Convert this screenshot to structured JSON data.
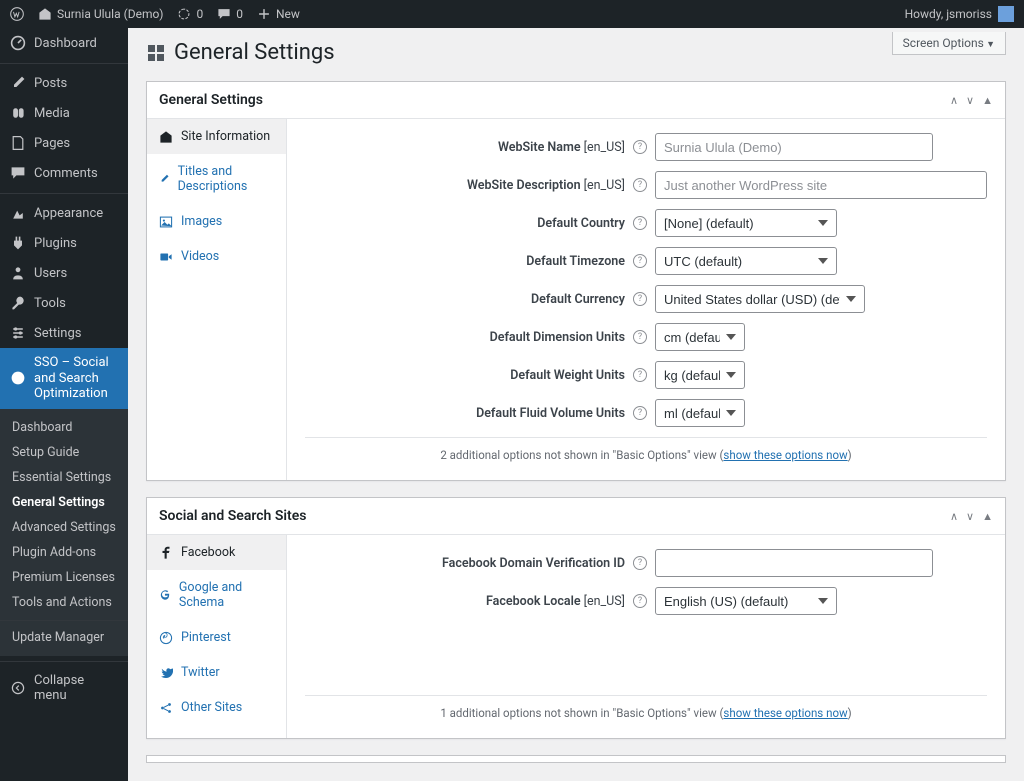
{
  "adminbar": {
    "site_name": "Surnia Ulula (Demo)",
    "updates_count": "0",
    "comments_count": "0",
    "new_label": "New",
    "howdy": "Howdy, jsmoriss"
  },
  "screen_options_label": "Screen Options",
  "page_title": "General Settings",
  "sidebar": {
    "dashboard": "Dashboard",
    "posts": "Posts",
    "media": "Media",
    "pages": "Pages",
    "comments": "Comments",
    "appearance": "Appearance",
    "plugins": "Plugins",
    "users": "Users",
    "tools": "Tools",
    "settings": "Settings",
    "sso": "SSO – Social and Search Optimization",
    "collapse": "Collapse menu"
  },
  "sso_submenu": {
    "dashboard": "Dashboard",
    "setup_guide": "Setup Guide",
    "essential": "Essential Settings",
    "general": "General Settings",
    "advanced": "Advanced Settings",
    "addons": "Plugin Add-ons",
    "licenses": "Premium Licenses",
    "tools_actions": "Tools and Actions",
    "update_manager": "Update Manager"
  },
  "box1": {
    "title": "General Settings",
    "tabs": {
      "site_info": "Site Information",
      "titles_desc": "Titles and Descriptions",
      "images": "Images",
      "videos": "Videos"
    },
    "fields": {
      "website_name_label": "WebSite Name",
      "website_name_locale": "[en_US]",
      "website_name_placeholder": "Surnia Ulula (Demo)",
      "website_desc_label": "WebSite Description",
      "website_desc_locale": "[en_US]",
      "website_desc_placeholder": "Just another WordPress site",
      "default_country_label": "Default Country",
      "default_country_value": "[None] (default)",
      "default_timezone_label": "Default Timezone",
      "default_timezone_value": "UTC (default)",
      "default_currency_label": "Default Currency",
      "default_currency_value": "United States dollar (USD) (defaul",
      "default_dim_label": "Default Dimension Units",
      "default_dim_value": "cm (defau",
      "default_weight_label": "Default Weight Units",
      "default_weight_value": "kg (defaul",
      "default_fluid_label": "Default Fluid Volume Units",
      "default_fluid_value": "ml (defaul"
    },
    "note_prefix": "2 additional options not shown in \"Basic Options\" view (",
    "note_link": "show these options now",
    "note_suffix": ")"
  },
  "box2": {
    "title": "Social and Search Sites",
    "tabs": {
      "facebook": "Facebook",
      "google": "Google and Schema",
      "pinterest": "Pinterest",
      "twitter": "Twitter",
      "other": "Other Sites"
    },
    "fields": {
      "fb_domain_label": "Facebook Domain Verification ID",
      "fb_locale_label": "Facebook Locale",
      "fb_locale_locale": "[en_US]",
      "fb_locale_value": "English (US) (default)"
    },
    "note_prefix": "1 additional options not shown in \"Basic Options\" view (",
    "note_link": "show these options now",
    "note_suffix": ")"
  }
}
